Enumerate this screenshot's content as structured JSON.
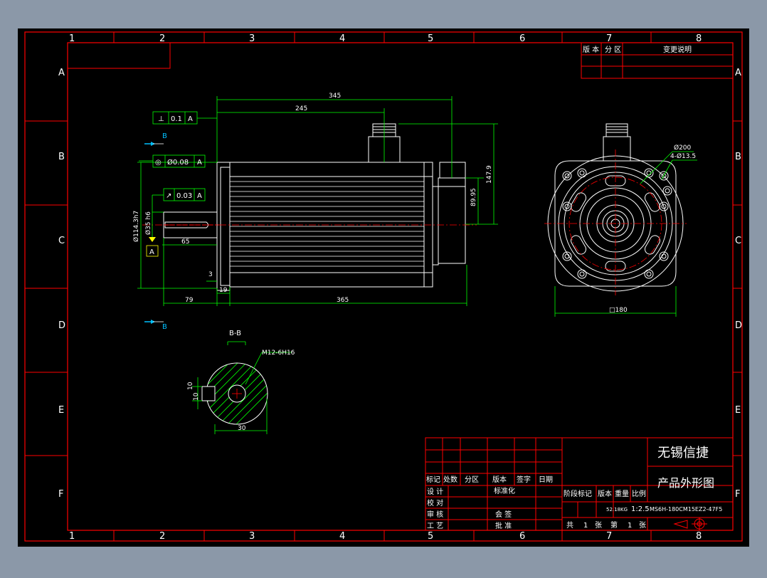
{
  "colors": {
    "background": "#8b98a8",
    "canvas": "#000000",
    "frame": "#ff0000",
    "dimension": "#00ff00",
    "geometry": "#ffffff",
    "label_text": "#ffffff",
    "marker": "#00c0ff",
    "datum": "#ffff00"
  },
  "grid": {
    "columns": [
      "1",
      "2",
      "3",
      "4",
      "5",
      "6",
      "7",
      "8"
    ],
    "rows": [
      "A",
      "B",
      "C",
      "D",
      "E",
      "F"
    ]
  },
  "revision_table": {
    "headers": [
      "版 本",
      "分 区",
      "变更说明"
    ]
  },
  "side_view": {
    "dims": {
      "overall_345": "345",
      "body_245": "245",
      "connector_147_9": "147.9",
      "connector_89_95": "89.95",
      "pilot_114": "Ø114.3h7",
      "shaft_35": "Ø35 h6",
      "shaft_65": "65",
      "flange_3": "3",
      "flange_19": "19",
      "shaft_79": "79",
      "length_365": "365"
    },
    "tolerances": [
      {
        "symbol": "⊥",
        "value": "0.1",
        "datum": "A"
      },
      {
        "symbol": "◎",
        "value": "Ø0.08",
        "datum": "A"
      },
      {
        "symbol": "↗",
        "value": "0.03",
        "datum": "A"
      }
    ],
    "datum_label": "A",
    "section_marker": "B"
  },
  "front_view": {
    "dims": {
      "pcd": "Ø200",
      "holes": "4-Ø13.5",
      "square": "□180"
    }
  },
  "section_view": {
    "title": "B-B",
    "thread": "M12-6H16",
    "key_depth": "10",
    "key_width": "10",
    "width_30": "30"
  },
  "title_block": {
    "company": "无锡信捷",
    "drawing_name": "产品外形图",
    "header_cells": [
      "标记",
      "处数",
      "分区",
      "版本",
      "签字",
      "日期"
    ],
    "role_rows": [
      "设 计",
      "校 对",
      "审 核",
      "工 艺"
    ],
    "standardize": "标准化",
    "countersign": "会 签",
    "approve": "批 准",
    "stage_cells": [
      "阶段标记",
      "版本",
      "重量",
      "比例"
    ],
    "weight": "52.18KG",
    "scale": "1:2.5",
    "model": "MS6H-180CM15EZ2-47F5",
    "sheet_info": [
      "共",
      "1",
      "张",
      "第",
      "1",
      "张"
    ]
  }
}
